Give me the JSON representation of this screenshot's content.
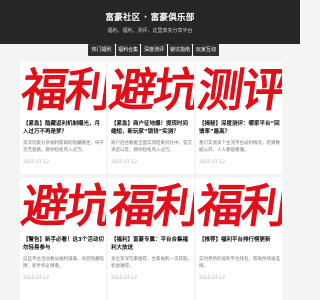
{
  "header": {
    "title": "富豪社区 · 富豪俱乐部",
    "subtitle": "福利、福利、测评，这里真实分享平台"
  },
  "nav": [
    {
      "label": "热门福利"
    },
    {
      "label": "福利合集"
    },
    {
      "label": "深度测评"
    },
    {
      "label": "避坑指南"
    },
    {
      "label": "玩家互动"
    }
  ],
  "cards": [
    {
      "thumb": "福利",
      "title": "【紧急】隐藏返利机制曝光，月入过万不再是梦？",
      "desc": "资深玩家分享福利获取的隐藏路径，纯干货无套路，教你轻松月入过万。",
      "date": "2025-07-12"
    },
    {
      "thumb": "避坑",
      "title": "【紧急】商户征地爆！提现时间缩短，新玩家“锁钱”实测？",
      "desc": "商户后台数据全面实测结果对比中，官方承诺以及，教你轻松月入过万。",
      "date": "2025-07-12"
    },
    {
      "thumb": "测评",
      "title": "【揭秘】深度测评：哪家平台“回馈率”最高？",
      "desc": "我们实测多个主流平台返利情况，结果数据公开，人人都能看懂。",
      "date": "2025-07-12"
    },
    {
      "thumb": "避坑",
      "title": "【警告】新手必看！这3个活动切勿轻易参与",
      "desc": "这些平台活动看似福利满满，背后隐藏陷阱，新手务必慎重。",
      "date": "2025-07-12"
    },
    {
      "thumb": "福利",
      "title": "【福利】富豪专属：平台合集福利大放送",
      "desc": "多位资深玩家推荐，合集福利一次获取，机会难得。",
      "date": "2025-07-12"
    },
    {
      "thumb": "福利",
      "title": "【推荐】福利平台排行榜更新",
      "desc": "实时更新的福利平台排名，帮助你快速选择。",
      "date": "2025-07-12"
    }
  ]
}
